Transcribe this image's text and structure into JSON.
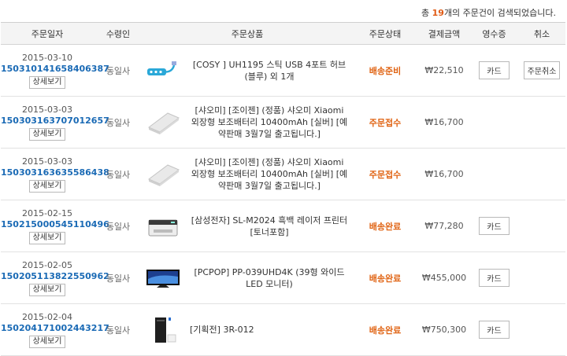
{
  "summary": {
    "prefix": "총 ",
    "count": "19",
    "suffix": "개의 주문건이 검색되었습니다."
  },
  "columns": [
    "주문일자",
    "수령인",
    "주문상품",
    "주문상태",
    "결제금액",
    "영수증",
    "취소"
  ],
  "detail_button": "상세보기",
  "orders": [
    {
      "date": "2015-03-10",
      "order_no": "150310141658406387",
      "recipient": "동일사",
      "product": "[COSY ] UH1195 스틱 USB 4포트 허브 (블루) 외 1개",
      "thumb_icon": "usb-hub-icon",
      "status": "배송준비",
      "amount": "₩22,510",
      "receipt": "카드",
      "cancel": "주문취소"
    },
    {
      "date": "2015-03-03",
      "order_no": "150303163707012657",
      "recipient": "동일사",
      "product": "[샤오미] [조이젠] (정품) 샤오미 Xiaomi 외장형 보조배터리 10400mAh [실버] [예약판매 3월7일 출고됩니다.]",
      "thumb_icon": "power-bank-icon",
      "status": "주문접수",
      "amount": "₩16,700",
      "receipt": "",
      "cancel": ""
    },
    {
      "date": "2015-03-03",
      "order_no": "150303163635586438",
      "recipient": "동일사",
      "product": "[샤오미] [조이젠] (정품) 샤오미 Xiaomi 외장형 보조배터리 10400mAh [실버] [예약판매 3월7일 출고됩니다.]",
      "thumb_icon": "power-bank-icon",
      "status": "주문접수",
      "amount": "₩16,700",
      "receipt": "",
      "cancel": ""
    },
    {
      "date": "2015-02-15",
      "order_no": "150215000545110496",
      "recipient": "동일사",
      "product": "[삼성전자] SL-M2024 흑백 레이저 프린터 [토너포함]",
      "thumb_icon": "printer-icon",
      "status": "배송완료",
      "amount": "₩77,280",
      "receipt": "카드",
      "cancel": ""
    },
    {
      "date": "2015-02-05",
      "order_no": "150205113822550962",
      "recipient": "동일사",
      "product": "[PCPOP] PP-039UHD4K (39형 와이드 LED 모니터)",
      "thumb_icon": "monitor-icon",
      "status": "배송완료",
      "amount": "₩455,000",
      "receipt": "카드",
      "cancel": ""
    },
    {
      "date": "2015-02-04",
      "order_no": "150204171002443217",
      "recipient": "동일사",
      "product": "[기획전] 3R-012",
      "thumb_icon": "pc-case-icon",
      "status": "배송완료",
      "amount": "₩750,300",
      "receipt": "카드",
      "cancel": ""
    }
  ]
}
